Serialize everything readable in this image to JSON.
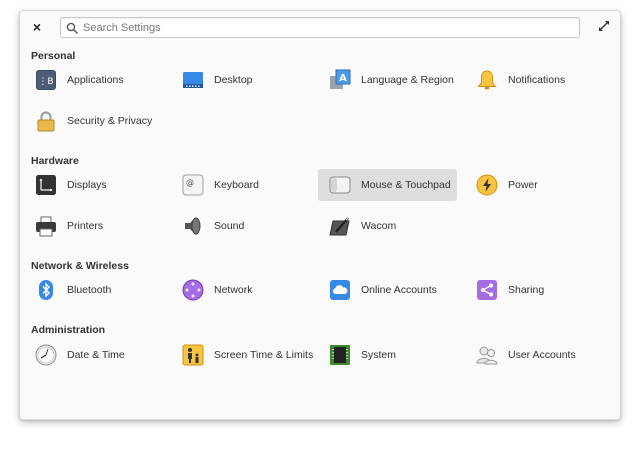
{
  "window": {
    "close_glyph": "×",
    "search_placeholder": "Search Settings",
    "search_value": ""
  },
  "sections": {
    "personal": {
      "title": "Personal",
      "items": [
        {
          "label": "Applications",
          "icon": "applications-icon"
        },
        {
          "label": "Desktop",
          "icon": "desktop-icon"
        },
        {
          "label": "Language & Region",
          "icon": "language-region-icon"
        },
        {
          "label": "Notifications",
          "icon": "notifications-bell-icon"
        },
        {
          "label": "Security & Privacy",
          "icon": "padlock-icon"
        }
      ]
    },
    "hardware": {
      "title": "Hardware",
      "items": [
        {
          "label": "Displays",
          "icon": "displays-icon"
        },
        {
          "label": "Keyboard",
          "icon": "keyboard-icon"
        },
        {
          "label": "Mouse & Touchpad",
          "icon": "mouse-touchpad-icon",
          "selected": true
        },
        {
          "label": "Power",
          "icon": "power-bolt-icon"
        },
        {
          "label": "Printers",
          "icon": "printer-icon"
        },
        {
          "label": "Sound",
          "icon": "speaker-icon"
        },
        {
          "label": "Wacom",
          "icon": "wacom-tablet-icon"
        }
      ]
    },
    "network": {
      "title": "Network & Wireless",
      "items": [
        {
          "label": "Bluetooth",
          "icon": "bluetooth-icon"
        },
        {
          "label": "Network",
          "icon": "network-icon"
        },
        {
          "label": "Online Accounts",
          "icon": "cloud-icon"
        },
        {
          "label": "Sharing",
          "icon": "sharing-icon"
        }
      ]
    },
    "administration": {
      "title": "Administration",
      "items": [
        {
          "label": "Date & Time",
          "icon": "clock-icon"
        },
        {
          "label": "Screen Time & Limits",
          "icon": "screen-time-icon"
        },
        {
          "label": "System",
          "icon": "system-chip-icon"
        },
        {
          "label": "User Accounts",
          "icon": "users-icon"
        }
      ]
    }
  },
  "colors": {
    "selected_bg": "#dedede",
    "accent_blue": "#3689e6",
    "notify_yellow": "#f9c440",
    "sharing_purple": "#a56de2"
  }
}
